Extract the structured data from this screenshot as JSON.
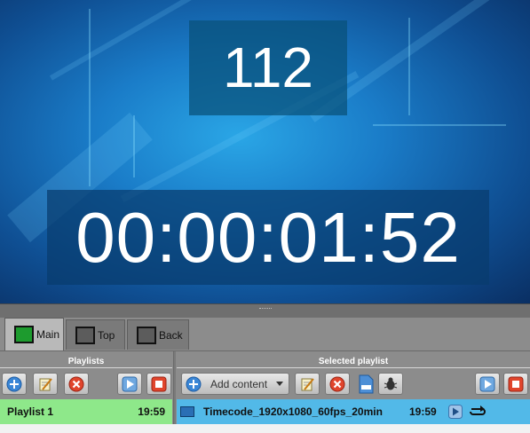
{
  "preview": {
    "frame_counter": "112",
    "timecode": "00:00:01:52"
  },
  "tabs": [
    {
      "label": "Main",
      "active": true,
      "icon": "green-screen-icon"
    },
    {
      "label": "Top",
      "active": false,
      "icon": "black-screen-icon"
    },
    {
      "label": "Back",
      "active": false,
      "icon": "black-screen-icon"
    }
  ],
  "sections": {
    "playlists": "Playlists",
    "selected_playlist": "Selected playlist"
  },
  "toolbar": {
    "add_content_label": "Add content"
  },
  "playlists": [
    {
      "name": "Playlist 1",
      "duration": "19:59"
    }
  ],
  "selected_playlist_items": [
    {
      "name": "Timecode_1920x1080_60fps_20min",
      "duration": "19:59"
    }
  ],
  "colors": {
    "playlist_row": "#8ee88a",
    "selected_item_row": "#52b9e8",
    "tab_main_icon": "#1d9b2e"
  }
}
